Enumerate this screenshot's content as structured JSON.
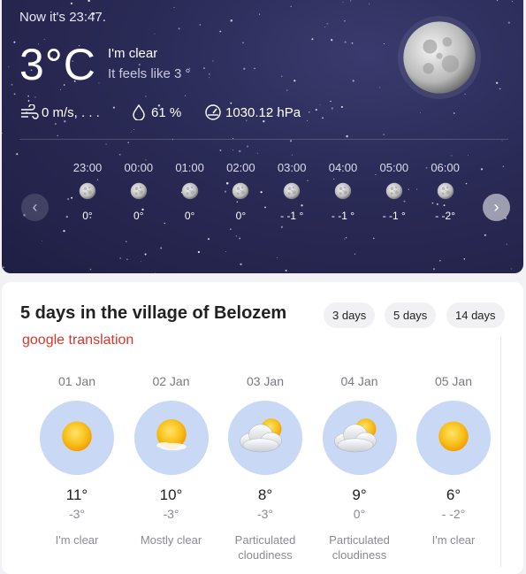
{
  "current": {
    "now_text": "Now it's 23:47.",
    "temperature": "3°C",
    "condition": "I'm clear",
    "feels_like": "It feels like 3 °",
    "wind": "0 m/s,  . . .",
    "humidity": "61 %",
    "pressure": "1030.12 hPa"
  },
  "hourly": [
    {
      "time": "23:00",
      "temp": "0°",
      "icon": "moon-icon"
    },
    {
      "time": "00:00",
      "temp": "0°",
      "icon": "moon-icon"
    },
    {
      "time": "01:00",
      "temp": "0°",
      "icon": "moon-icon"
    },
    {
      "time": "02:00",
      "temp": "0°",
      "icon": "moon-icon"
    },
    {
      "time": "03:00",
      "temp": "- -1 °",
      "icon": "moon-icon"
    },
    {
      "time": "04:00",
      "temp": "- -1 °",
      "icon": "moon-icon"
    },
    {
      "time": "05:00",
      "temp": "- -1 °",
      "icon": "moon-icon"
    },
    {
      "time": "06:00",
      "temp": "- -2°",
      "icon": "moon-icon"
    }
  ],
  "nav": {
    "prev": "‹",
    "next": "›"
  },
  "forecast": {
    "title": "5 days in the village of Belozem",
    "ranges": [
      "3 days",
      "5 days",
      "14 days"
    ],
    "translation_note": "google translation",
    "days": [
      {
        "date": "01 Jan",
        "high": "11°",
        "low": "-3°",
        "desc": "I'm clear",
        "icon": "sun-icon"
      },
      {
        "date": "02 Jan",
        "high": "10°",
        "low": "-3°",
        "desc": "Mostly clear",
        "icon": "sun-small-cloud-icon"
      },
      {
        "date": "03 Jan",
        "high": "8°",
        "low": "-3°",
        "desc": "Particulated cloudiness",
        "icon": "sun-cloud-icon"
      },
      {
        "date": "04 Jan",
        "high": "9°",
        "low": "0°",
        "desc": "Particulated cloudiness",
        "icon": "sun-cloud-icon"
      },
      {
        "date": "05 Jan",
        "high": "6°",
        "low": "- -2°",
        "desc": "I'm clear",
        "icon": "sun-icon"
      }
    ]
  },
  "colors": {
    "night_bg": "#2a2a56",
    "sun": "#f7b417",
    "circle": "#c9d8f4",
    "note_red": "#d9352b"
  }
}
